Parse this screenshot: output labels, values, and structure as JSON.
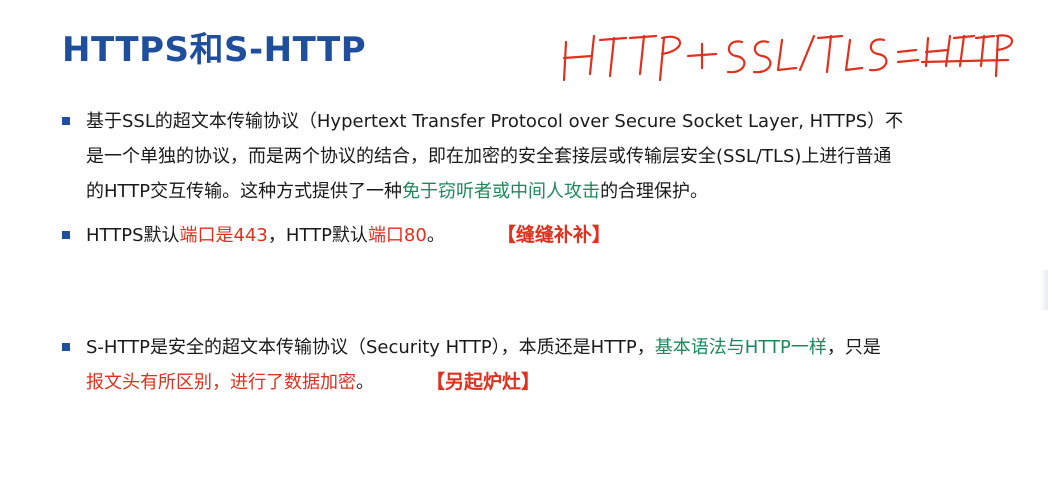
{
  "title": "HTTPS和S-HTTP",
  "handwritten_note": "HTTP + SSL/TLS = HTTPS",
  "bullets": [
    {
      "p1": "基于SSL的超文本传输协议（Hypertext Transfer Protocol over Secure Socket Layer, HTTPS）不",
      "p2": "是一个单独的协议，而是两个协议的结合，即在加密的安全套接层或传输层安全(SSL/TLS)上进行普通",
      "p3": "的HTTP交互传输。这种方式提供了一种",
      "p3_green": "免于窃听者或中间人攻击",
      "p3_end": "的合理保护。"
    },
    {
      "a": "HTTPS默认",
      "a_red": "端口是443",
      "b": "，HTTP默认",
      "b_red": "端口80",
      "c": "。",
      "tag": "【缝缝补补】"
    },
    {
      "a": "S-HTTP是安全的超文本传输协议（Security HTTP），本质还是HTTP，",
      "a_green": "基本语法与HTTP一样",
      "b": "，只是",
      "line2_red": "报文头有所区别，进行了数据加密",
      "line2_end": "。",
      "tag": "【另起炉灶】"
    }
  ],
  "colors": {
    "title": "#1f4e9c",
    "green": "#1b8a5a",
    "red": "#e0301e"
  }
}
